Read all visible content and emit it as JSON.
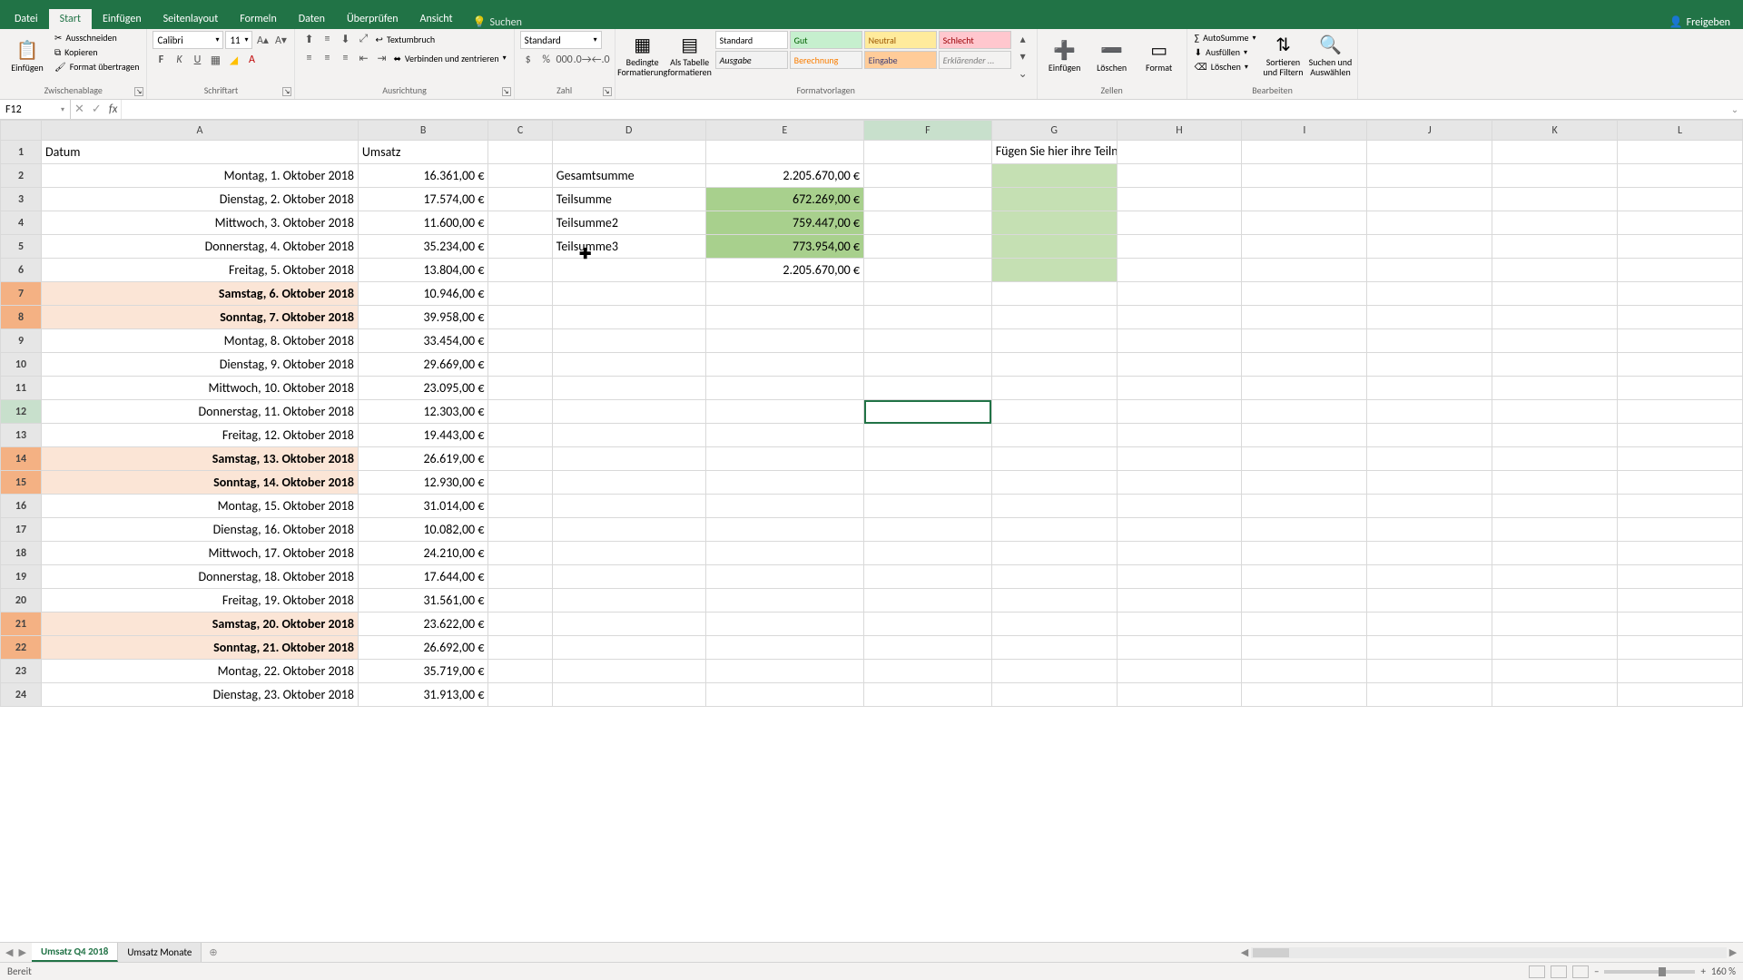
{
  "tabs": {
    "datei": "Datei",
    "start": "Start",
    "einfuegen": "Einfügen",
    "seitenlayout": "Seitenlayout",
    "formeln": "Formeln",
    "daten": "Daten",
    "ueberpruefen": "Überprüfen",
    "ansicht": "Ansicht"
  },
  "search_label": "Suchen",
  "share_label": "Freigeben",
  "clipboard": {
    "paste": "Einfügen",
    "cut": "Ausschneiden",
    "copy": "Kopieren",
    "format_painter": "Format übertragen",
    "group": "Zwischenablage"
  },
  "font": {
    "name": "Calibri",
    "size": "11",
    "group": "Schriftart"
  },
  "alignment": {
    "wrap": "Textumbruch",
    "merge": "Verbinden und zentrieren",
    "group": "Ausrichtung"
  },
  "number": {
    "format": "Standard",
    "group": "Zahl"
  },
  "cond": {
    "cond_format": "Bedingte Formatierung",
    "as_table": "Als Tabelle formatieren"
  },
  "cell_styles": {
    "standard": "Standard",
    "gut": "Gut",
    "neutral": "Neutral",
    "schlecht": "Schlecht",
    "ausgabe": "Ausgabe",
    "berechnung": "Berechnung",
    "eingabe": "Eingabe",
    "erklaerend": "Erklärender ...",
    "group": "Formatvorlagen"
  },
  "cells": {
    "insert": "Einfügen",
    "delete": "Löschen",
    "format": "Format",
    "group": "Zellen"
  },
  "editing": {
    "autosum": "AutoSumme",
    "fill": "Ausfüllen",
    "clear": "Löschen",
    "sort": "Sortieren und Filtern",
    "find": "Suchen und Auswählen",
    "group": "Bearbeiten"
  },
  "namebox": "F12",
  "formula": "",
  "columns": [
    "A",
    "B",
    "C",
    "D",
    "E",
    "F",
    "G",
    "H",
    "I",
    "J",
    "K",
    "L"
  ],
  "headers": {
    "A": "Datum",
    "B": "Umsatz"
  },
  "practice_text": "Fügen Sie hier ihre Teilnummen ein zur Übung",
  "summary": [
    {
      "label": "Gesamtsumme",
      "value": "2.205.670,00 €",
      "green": false
    },
    {
      "label": "Teilsumme",
      "value": "672.269,00 €",
      "green": true
    },
    {
      "label": "Teilsumme2",
      "value": "759.447,00 €",
      "green": true
    },
    {
      "label": "Teilsumme3",
      "value": "773.954,00 €",
      "green": true
    },
    {
      "label": "",
      "value": "2.205.670,00 €",
      "green": false
    }
  ],
  "rows": [
    {
      "n": 1
    },
    {
      "n": 2,
      "date": "Montag, 1. Oktober 2018",
      "amt": "16.361,00 €"
    },
    {
      "n": 3,
      "date": "Dienstag, 2. Oktober 2018",
      "amt": "17.574,00 €"
    },
    {
      "n": 4,
      "date": "Mittwoch, 3. Oktober 2018",
      "amt": "11.600,00 €"
    },
    {
      "n": 5,
      "date": "Donnerstag, 4. Oktober 2018",
      "amt": "35.234,00 €"
    },
    {
      "n": 6,
      "date": "Freitag, 5. Oktober 2018",
      "amt": "13.804,00 €"
    },
    {
      "n": 7,
      "date": "Samstag, 6. Oktober 2018",
      "amt": "10.946,00 €",
      "weekend": true
    },
    {
      "n": 8,
      "date": "Sonntag, 7. Oktober 2018",
      "amt": "39.958,00 €",
      "weekend": true
    },
    {
      "n": 9,
      "date": "Montag, 8. Oktober 2018",
      "amt": "33.454,00 €"
    },
    {
      "n": 10,
      "date": "Dienstag, 9. Oktober 2018",
      "amt": "29.669,00 €"
    },
    {
      "n": 11,
      "date": "Mittwoch, 10. Oktober 2018",
      "amt": "23.095,00 €"
    },
    {
      "n": 12,
      "date": "Donnerstag, 11. Oktober 2018",
      "amt": "12.303,00 €"
    },
    {
      "n": 13,
      "date": "Freitag, 12. Oktober 2018",
      "amt": "19.443,00 €"
    },
    {
      "n": 14,
      "date": "Samstag, 13. Oktober 2018",
      "amt": "26.619,00 €",
      "weekend": true
    },
    {
      "n": 15,
      "date": "Sonntag, 14. Oktober 2018",
      "amt": "12.930,00 €",
      "weekend": true
    },
    {
      "n": 16,
      "date": "Montag, 15. Oktober 2018",
      "amt": "31.014,00 €"
    },
    {
      "n": 17,
      "date": "Dienstag, 16. Oktober 2018",
      "amt": "10.082,00 €"
    },
    {
      "n": 18,
      "date": "Mittwoch, 17. Oktober 2018",
      "amt": "24.210,00 €"
    },
    {
      "n": 19,
      "date": "Donnerstag, 18. Oktober 2018",
      "amt": "17.644,00 €"
    },
    {
      "n": 20,
      "date": "Freitag, 19. Oktober 2018",
      "amt": "31.561,00 €"
    },
    {
      "n": 21,
      "date": "Samstag, 20. Oktober 2018",
      "amt": "23.622,00 €",
      "weekend": true
    },
    {
      "n": 22,
      "date": "Sonntag, 21. Oktober 2018",
      "amt": "26.692,00 €",
      "weekend": true
    },
    {
      "n": 23,
      "date": "Montag, 22. Oktober 2018",
      "amt": "35.719,00 €"
    },
    {
      "n": 24,
      "date": "Dienstag, 23. Oktober 2018",
      "amt": "31.913,00 €"
    }
  ],
  "selected_col": "F",
  "selected_row": 12,
  "sheet_tabs": {
    "active": "Umsatz Q4 2018",
    "other": "Umsatz Monate"
  },
  "status": {
    "ready": "Bereit",
    "zoom": "160 %"
  }
}
